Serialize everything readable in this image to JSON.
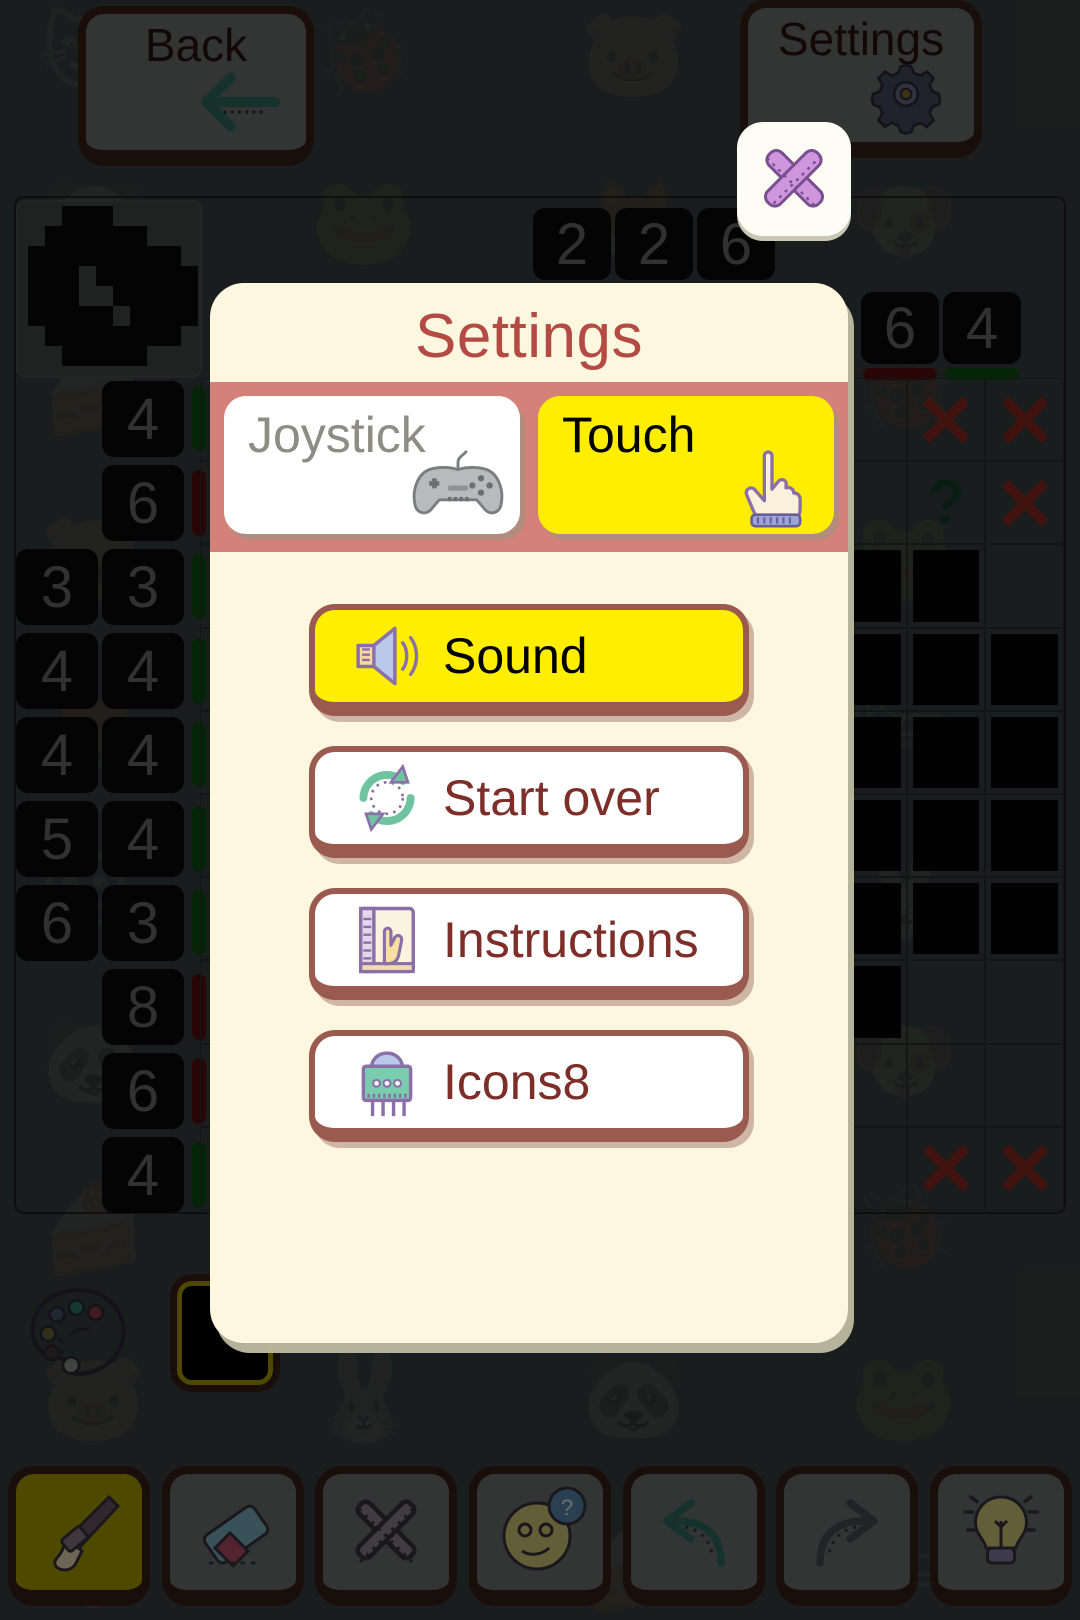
{
  "app": {
    "background_tint": "#3b4240",
    "wallpaper_glyphs": [
      "🐱",
      "🐞",
      "🐷",
      "🐰",
      "🐼",
      "🐸",
      "🦊",
      "🐶",
      "🍰",
      "🛏"
    ]
  },
  "topbar": {
    "back": {
      "label": "Back",
      "icon": "left-arrow-icon"
    },
    "settings": {
      "label": "Settings",
      "icon": "gear-icon"
    },
    "close": {
      "icon": "close-x-icon"
    }
  },
  "puzzle": {
    "thumbnail_alt": "puzzle-preview",
    "column_clues_top": [
      "2",
      "2",
      "6"
    ],
    "column_clues_right": [
      "6",
      "4"
    ],
    "column_status": [
      "red",
      "red",
      "green"
    ],
    "row_clues": [
      {
        "cells": [
          "",
          "4"
        ],
        "status": "green"
      },
      {
        "cells": [
          "",
          "6"
        ],
        "status": "red"
      },
      {
        "cells": [
          "3",
          "3"
        ],
        "status": "green"
      },
      {
        "cells": [
          "4",
          "4"
        ],
        "status": "green"
      },
      {
        "cells": [
          "4",
          "4"
        ],
        "status": "green"
      },
      {
        "cells": [
          "5",
          "4"
        ],
        "status": "green"
      },
      {
        "cells": [
          "6",
          "3"
        ],
        "status": "green"
      },
      {
        "cells": [
          "",
          "8"
        ],
        "status": "red"
      },
      {
        "cells": [
          "",
          "6"
        ],
        "status": "red"
      },
      {
        "cells": [
          "",
          "4"
        ],
        "status": "green"
      }
    ],
    "marks": {
      "filled": "filled-cell",
      "cross": "cross-mark",
      "question": "?"
    }
  },
  "palette": {
    "palette_icon": "color-palette-icon",
    "selected_color": "#000000"
  },
  "toolbar": {
    "items": [
      {
        "name": "brush-tool",
        "icon": "paintbrush-icon",
        "active": true
      },
      {
        "name": "eraser-tool",
        "icon": "eraser-icon",
        "active": false
      },
      {
        "name": "cross-tool",
        "icon": "x-mark-icon",
        "active": false
      },
      {
        "name": "question-tool",
        "icon": "thinking-face-icon",
        "active": false
      },
      {
        "name": "undo-button",
        "icon": "undo-arrow-icon",
        "active": false
      },
      {
        "name": "redo-button",
        "icon": "redo-arrow-icon",
        "active": false
      },
      {
        "name": "hint-button",
        "icon": "lightbulb-icon",
        "active": false
      }
    ]
  },
  "settings_dialog": {
    "title": "Settings",
    "mode": {
      "options": [
        {
          "label": "Joystick",
          "icon": "gamepad-icon",
          "selected": false
        },
        {
          "label": "Touch",
          "icon": "pointing-hand-icon",
          "selected": true
        }
      ]
    },
    "menu": [
      {
        "label": "Sound",
        "icon": "speaker-icon",
        "on": true
      },
      {
        "label": "Start over",
        "icon": "restart-icon",
        "on": false
      },
      {
        "label": "Instructions",
        "icon": "manual-book-icon",
        "on": false
      },
      {
        "label": "Icons8",
        "icon": "icons8-logo-icon",
        "on": false
      }
    ]
  },
  "colors": {
    "accent_red": "#b34a43",
    "highlight_yellow": "#ffee00",
    "modal_bg": "#fdf7e0",
    "mode_bar": "#d4817a",
    "button_border": "#9b5a50"
  }
}
